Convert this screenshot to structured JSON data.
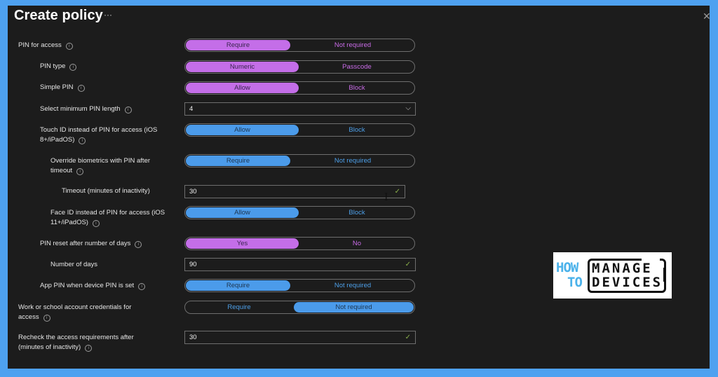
{
  "header": {
    "title": "Create policy",
    "more_icon": "ellipsis-icon",
    "close_icon": "close-icon"
  },
  "settings": [
    {
      "label": "PIN for access",
      "info": true,
      "type": "toggle",
      "color": "purple",
      "options": [
        "Require",
        "Not required"
      ],
      "selected": 0
    },
    {
      "label": "PIN type",
      "info": true,
      "type": "toggle",
      "color": "purple",
      "options": [
        "Numeric",
        "Passcode"
      ],
      "selected": 0
    },
    {
      "label": "Simple PIN",
      "info": true,
      "type": "toggle",
      "color": "purple",
      "options": [
        "Allow",
        "Block"
      ],
      "selected": 0
    },
    {
      "label": "Select minimum PIN length",
      "info": true,
      "type": "dropdown",
      "value": "4"
    },
    {
      "label": "Touch ID instead of PIN for access (iOS 8+/iPadOS)",
      "info": true,
      "type": "toggle",
      "color": "blue",
      "options": [
        "Allow",
        "Block"
      ],
      "selected": 0
    },
    {
      "label": "Override biometrics with PIN after timeout",
      "info": true,
      "type": "toggle",
      "color": "blue",
      "options": [
        "Require",
        "Not required"
      ],
      "selected": 0
    },
    {
      "label": "Timeout (minutes of inactivity)",
      "info": false,
      "type": "input",
      "value": "30",
      "valid": true
    },
    {
      "label": "Face ID instead of PIN for access (iOS 11+/iPadOS)",
      "info": true,
      "type": "toggle",
      "color": "blue",
      "options": [
        "Allow",
        "Block"
      ],
      "selected": 0
    },
    {
      "label": "PIN reset after number of days",
      "info": true,
      "type": "toggle",
      "color": "purple",
      "options": [
        "Yes",
        "No"
      ],
      "selected": 0
    },
    {
      "label": "Number of days",
      "info": false,
      "type": "input",
      "value": "90",
      "valid": true
    },
    {
      "label": "App PIN when device PIN is set",
      "info": true,
      "type": "toggle",
      "color": "blue",
      "options": [
        "Require",
        "Not required"
      ],
      "selected": 0
    },
    {
      "label": "Work or school account credentials for access",
      "info": true,
      "type": "toggle",
      "color": "blue",
      "options": [
        "Require",
        "Not required"
      ],
      "selected": 1
    },
    {
      "label": "Recheck the access requirements after (minutes of inactivity)",
      "info": true,
      "type": "input",
      "value": "30",
      "valid": true
    }
  ],
  "logo": {
    "line_how": "HOW",
    "line_to": "TO",
    "line_manage": "MANAGE",
    "line_devices": "DEVICES"
  },
  "colors": {
    "purple_accent": "#c46ee8",
    "blue_accent": "#4b9bea",
    "panel_bg": "#1c1c1c",
    "page_bg": "#4ea1f0",
    "valid_check": "#8ab04b"
  }
}
